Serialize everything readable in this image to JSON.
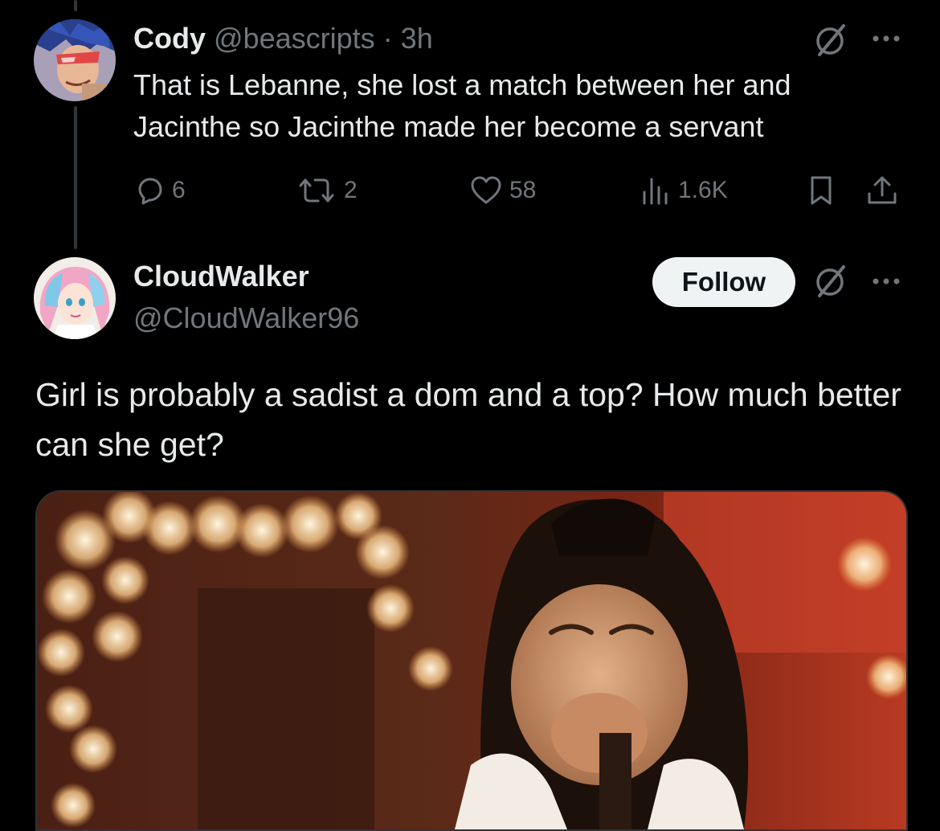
{
  "reply": {
    "display_name": "Cody",
    "handle": "@beascripts",
    "separator": "·",
    "time": "3h",
    "text": "That is Lebanne, she lost a match between her and Jacinthe so Jacinthe made her become a servant",
    "stats": {
      "replies": "6",
      "reposts": "2",
      "likes": "58",
      "views": "1.6K"
    }
  },
  "post": {
    "display_name": "CloudWalker",
    "handle": "@CloudWalker96",
    "follow_label": "Follow",
    "text": "Girl is probably a sadist a dom and a top? How much better can she get?",
    "media_type": "gif"
  },
  "icons": {
    "reply": "reply-icon",
    "repost": "repost-icon",
    "like": "heart-icon",
    "views": "views-icon",
    "bookmark": "bookmark-icon",
    "share": "share-icon",
    "grok": "grok-icon",
    "more": "more-icon"
  },
  "colors": {
    "background": "#000000",
    "text_primary": "#e7e9ea",
    "text_muted": "#71767b",
    "follow_bg": "#eff3f4",
    "thread_line": "#333639"
  }
}
